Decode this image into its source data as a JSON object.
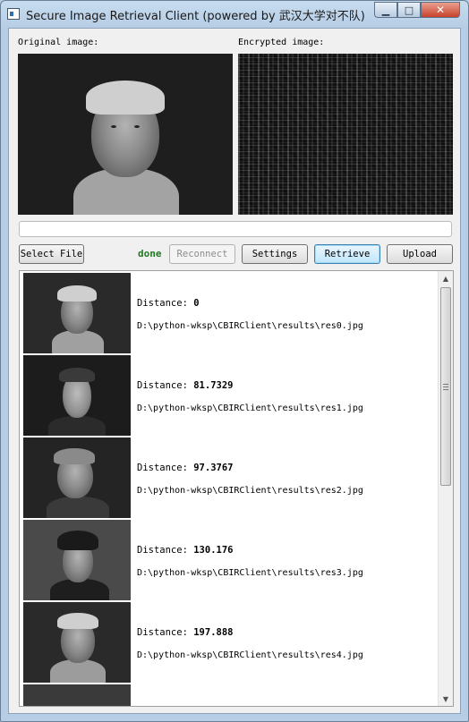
{
  "window": {
    "title": "Secure Image Retrieval Client (powered by 武汉大学对不队)",
    "min_glyph": "▁",
    "max_glyph": "□",
    "close_glyph": "✕"
  },
  "labels": {
    "original": "Original image:",
    "encrypted": "Encrypted image:"
  },
  "progress": {
    "value_percent": 0
  },
  "toolbar": {
    "select_file": "Select File",
    "status": "done",
    "reconnect": "Reconnect",
    "settings": "Settings",
    "retrieve": "Retrieve",
    "upload": "Upload"
  },
  "colors": {
    "status_done": "#1f7a1f",
    "focused_button": "#3c7fb1"
  },
  "results": {
    "distance_label": "Distance:",
    "items": [
      {
        "distance": "0",
        "path": "D:\\python-wksp\\CBIRClient\\results\\res0.jpg"
      },
      {
        "distance": "81.7329",
        "path": "D:\\python-wksp\\CBIRClient\\results\\res1.jpg"
      },
      {
        "distance": "97.3767",
        "path": "D:\\python-wksp\\CBIRClient\\results\\res2.jpg"
      },
      {
        "distance": "130.176",
        "path": "D:\\python-wksp\\CBIRClient\\results\\res3.jpg"
      },
      {
        "distance": "197.888",
        "path": "D:\\python-wksp\\CBIRClient\\results\\res4.jpg"
      }
    ]
  },
  "scrollbar": {
    "up_glyph": "▲",
    "down_glyph": "▼"
  }
}
